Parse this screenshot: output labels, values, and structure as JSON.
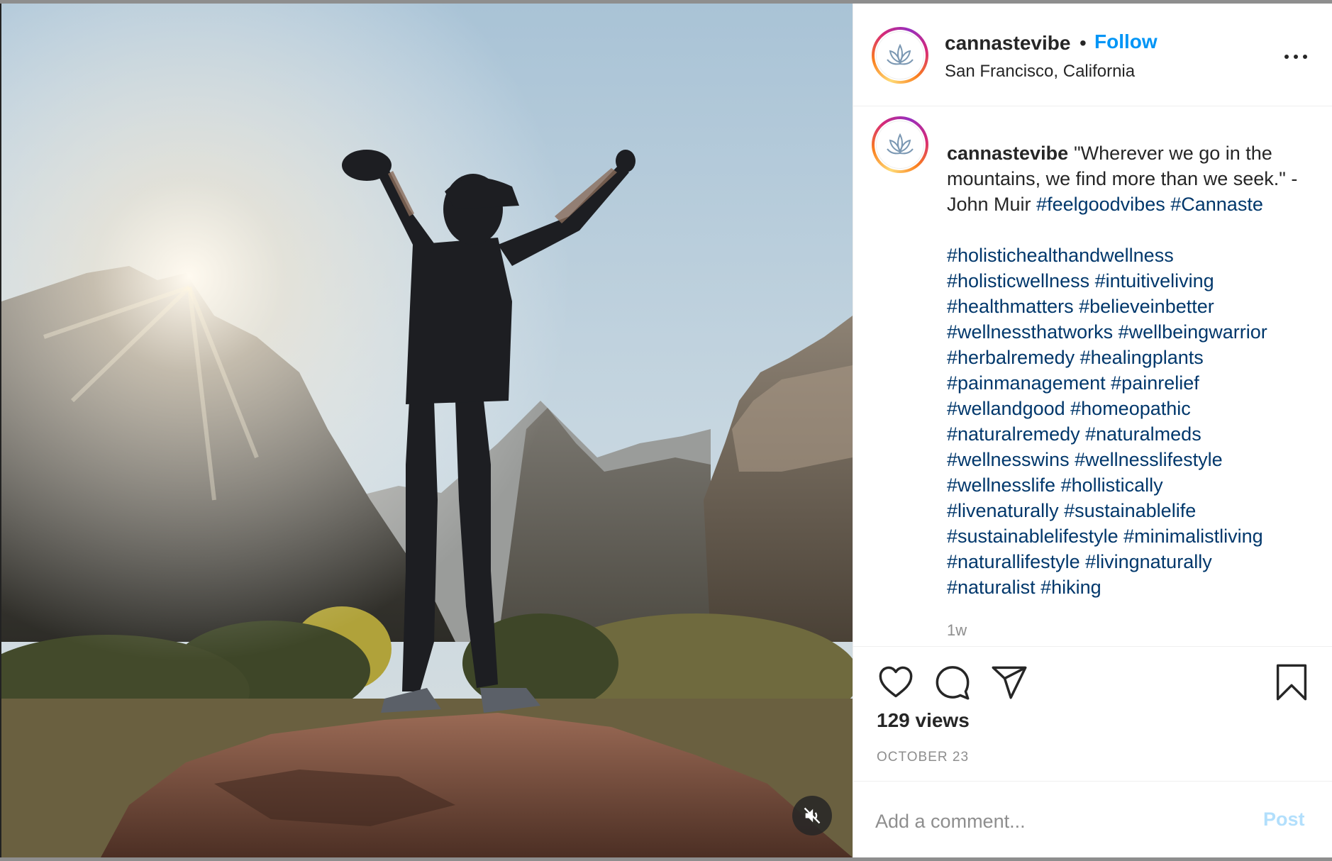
{
  "post": {
    "username": "cannastevibe",
    "separator": "•",
    "follow_label": "Follow",
    "location": "San Francisco, California",
    "more_icon": "more-options-icon"
  },
  "caption": {
    "username": "cannastevibe",
    "quote": "\"Wherever we go in the mountains, we find more than we seek.\" -John Muir",
    "inline_tags": [
      "#feelgoodvibes",
      "#Cannaste"
    ],
    "tag_lines": [
      "#holistichealthandwellness",
      "#holisticwellness #intuitiveliving",
      "#healthmatters #believeinbetter",
      "#wellnessthatworks #wellbeingwarrior",
      "#herbalremedy #healingplants",
      "#painmanagement #painrelief",
      "#wellandgood #homeopathic",
      "#naturalremedy #naturalmeds",
      "#wellnesswins #wellnesslifestyle",
      "#wellnesslife #hollistically",
      "#livenaturally #sustainablelife",
      "#sustainablelifestyle #minimalistliving",
      "#naturallifestyle #livingnaturally",
      "#naturalist #hiking"
    ],
    "time_ago": "1w"
  },
  "actions": {
    "like_icon": "heart-icon",
    "comment_icon": "comment-icon",
    "share_icon": "share-icon",
    "save_icon": "bookmark-icon",
    "views": "129 views",
    "date": "OCTOBER 23"
  },
  "comment": {
    "placeholder": "Add a comment...",
    "post_label": "Post"
  },
  "media": {
    "mute_icon": "muted-speaker-icon"
  },
  "colors": {
    "link_blue": "#0095f6",
    "hashtag": "#00376b",
    "post_disabled": "#b2dffc",
    "muted_text": "#8e8e8e"
  }
}
